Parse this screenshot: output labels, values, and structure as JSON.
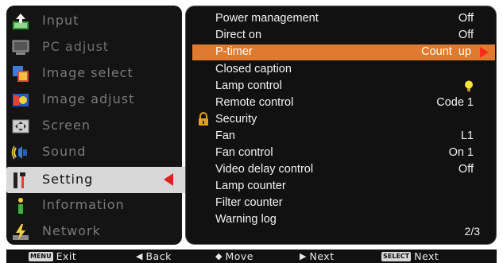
{
  "left_menu": {
    "items": [
      {
        "label": "Input",
        "icon": "input-icon"
      },
      {
        "label": "PC adjust",
        "icon": "pc-adjust-icon"
      },
      {
        "label": "Image select",
        "icon": "image-select-icon"
      },
      {
        "label": "Image adjust",
        "icon": "image-adjust-icon"
      },
      {
        "label": "Screen",
        "icon": "screen-icon"
      },
      {
        "label": "Sound",
        "icon": "sound-icon"
      },
      {
        "label": "Setting",
        "icon": "setting-icon"
      },
      {
        "label": "Information",
        "icon": "information-icon"
      },
      {
        "label": "Network",
        "icon": "network-icon"
      }
    ],
    "selected": "Setting"
  },
  "settings": {
    "rows": [
      {
        "label": "Power management",
        "value": "Off"
      },
      {
        "label": "Direct on",
        "value": "Off"
      },
      {
        "label": "P-timer",
        "value": "Count  up"
      },
      {
        "label": "Closed caption",
        "value": ""
      },
      {
        "label": "Lamp control",
        "value": "",
        "value_icon": "lamp-bulb-icon"
      },
      {
        "label": "Remote control",
        "value": "Code 1"
      },
      {
        "label": "Security",
        "value": "",
        "label_icon": "lock-icon"
      },
      {
        "label": "Fan",
        "value": "L1"
      },
      {
        "label": "Fan control",
        "value": "On 1"
      },
      {
        "label": "Video delay control",
        "value": "Off"
      },
      {
        "label": "Lamp counter",
        "value": ""
      },
      {
        "label": "Filter counter",
        "value": ""
      },
      {
        "label": "Warning log",
        "value": ""
      }
    ],
    "highlighted": "P-timer",
    "page": "2/3"
  },
  "bottom_bar": {
    "exit": {
      "key": "MENU",
      "label": "Exit"
    },
    "back": {
      "glyph": "◀",
      "label": "Back"
    },
    "move": {
      "glyph": "◆",
      "label": "Move"
    },
    "next": {
      "glyph": "▶",
      "label": "Next"
    },
    "select": {
      "key": "SELECT",
      "label": "Next"
    }
  },
  "colors": {
    "highlight": "#e07a2e",
    "arrow": "#e02020",
    "panel_bg": "#111111",
    "selected_item_bg": "#d8d8d8"
  }
}
